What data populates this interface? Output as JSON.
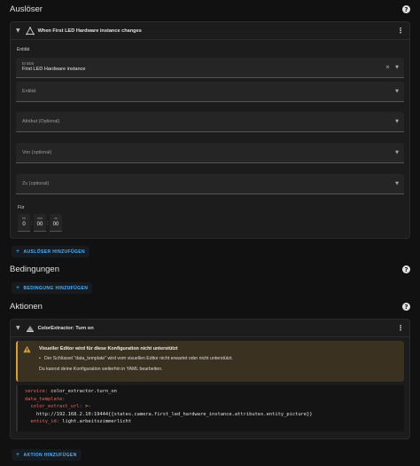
{
  "triggers": {
    "heading": "Auslöser",
    "card": {
      "title": "When First LED Hardware instance changes",
      "entity_section_label": "Entität",
      "entity_field": {
        "label": "Entität",
        "value": "First LED Hardware instance"
      },
      "entity_picker": {
        "placeholder": "Entität"
      },
      "attribute": {
        "placeholder": "Attribut (Optional)"
      },
      "from": {
        "placeholder": "Von (optional)"
      },
      "to": {
        "placeholder": "Zu (optional)"
      },
      "for_label": "Für",
      "duration": {
        "hours": {
          "label": "hh",
          "value": "0"
        },
        "minutes": {
          "label": "mm",
          "value": "00"
        },
        "seconds": {
          "label": "ss",
          "value": "00"
        }
      }
    },
    "add_label": "AUSLÖSER HINZUFÜGEN"
  },
  "conditions": {
    "heading": "Bedingungen",
    "add_label": "BEDINGUNG HINZUFÜGEN"
  },
  "actions": {
    "heading": "Aktionen",
    "card": {
      "title": "ColorExtractor: Turn on",
      "warning_title": "Visueller Editor wird für diese Konfiguration nicht unterstützt",
      "warning_bullet": "Der Schlüssel \"data_template\" wird vom visuellen Editor nicht erwartet oder nicht unterstützt.",
      "warning_note": "Du kannst deine Konfiguration weiterhin in YAML bearbeiten.",
      "yaml": {
        "service_key": "service:",
        "service_value": " color_extractor.turn_on",
        "data_template_key": "data_template:",
        "extract_url_key": "  color_extract_url:",
        "extract_url_indicator": " >-",
        "url_line": "    http://192.168.2.10:19444{{states.camera.first_led_hardware_instance.attributes.entity_picture}}",
        "entity_key": "  entity_id:",
        "entity_value": " light.arbeitszimmerlicht"
      }
    },
    "add_label": "AKTION HINZUFÜGEN"
  },
  "colors": {
    "accent": "#4fb3f6",
    "warning": "#d7a02a",
    "background": "#111111",
    "card": "#1c1c1c"
  },
  "icons": {
    "help": "help-circle-icon",
    "chevron": "chevron-down-icon",
    "trigger": "trigger-state-icon",
    "kebab": "more-vertical-icon",
    "action": "palette-icon",
    "warning": "alert-triangle-icon",
    "plus": "plus-icon"
  }
}
